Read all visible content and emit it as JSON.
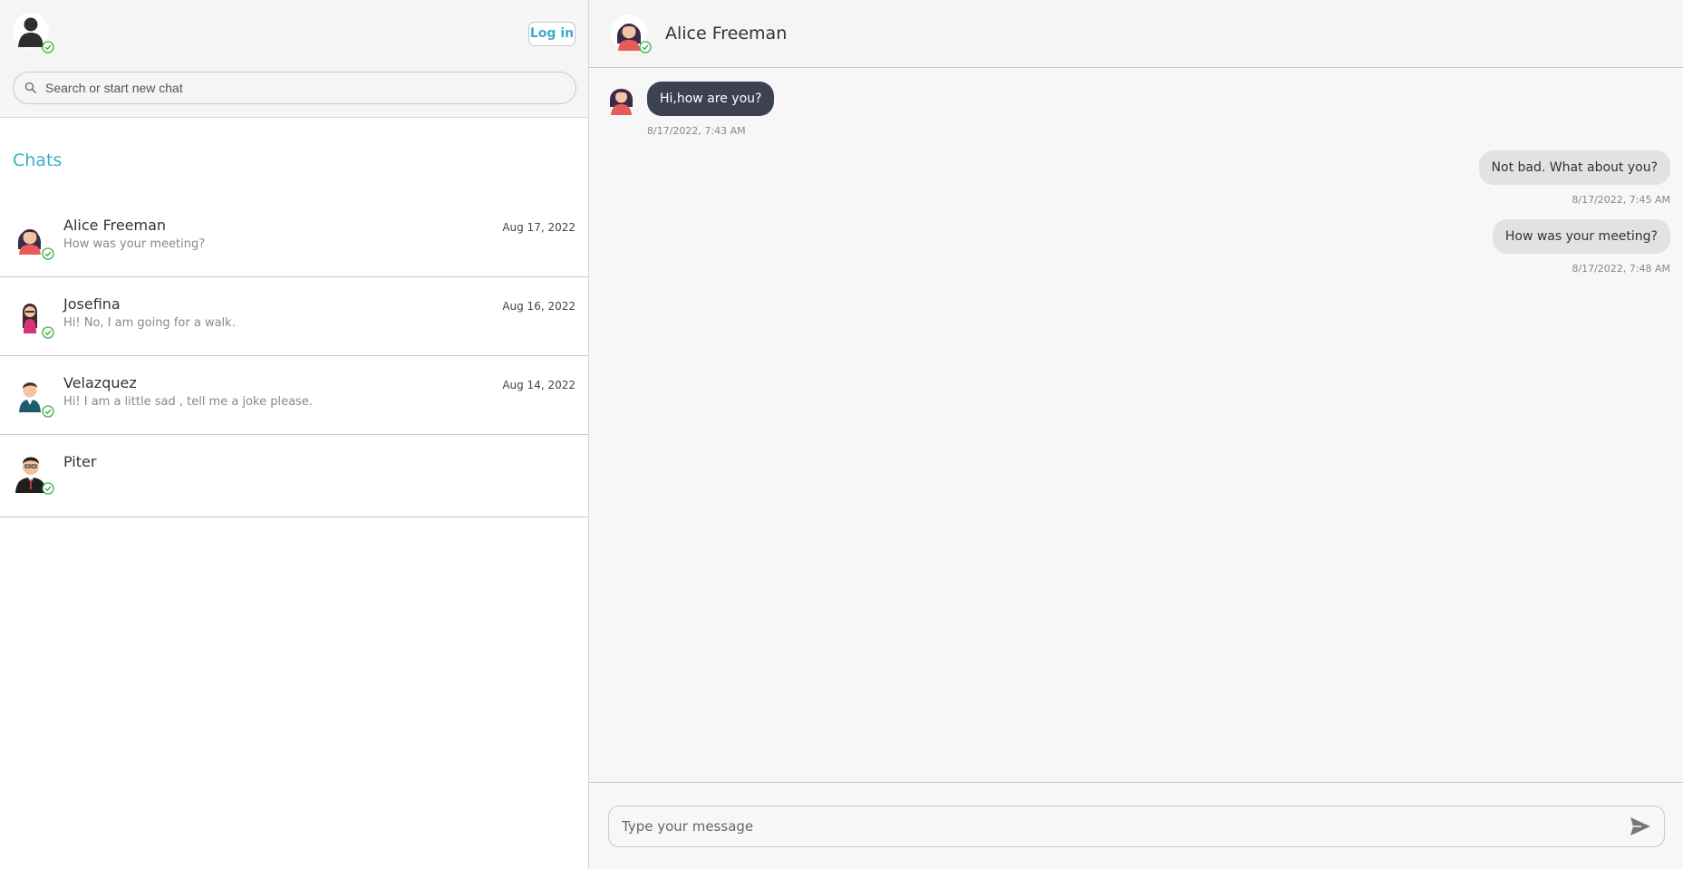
{
  "sidebar": {
    "login_label": "Log in",
    "search_placeholder": "Search or start new chat",
    "chats_title": "Chats",
    "chats": [
      {
        "name": "Alice Freeman",
        "preview": "How was your meeting?",
        "date": "Aug 17, 2022"
      },
      {
        "name": "Josefina",
        "preview": "Hi! No, I am going for a walk.",
        "date": "Aug 16, 2022"
      },
      {
        "name": "Velazquez",
        "preview": "Hi! I am a little sad , tell me a joke please.",
        "date": "Aug 14, 2022"
      },
      {
        "name": "Piter",
        "preview": "",
        "date": ""
      }
    ]
  },
  "conversation": {
    "title": "Alice Freeman",
    "messages": [
      {
        "direction": "in",
        "text": "Hi,how are you?",
        "time": "8/17/2022, 7:43 AM"
      },
      {
        "direction": "out",
        "text": "Not bad. What about you?",
        "time": "8/17/2022, 7:45 AM"
      },
      {
        "direction": "out",
        "text": "How was your meeting?",
        "time": "8/17/2022, 7:48 AM"
      }
    ],
    "input_placeholder": "Type your message"
  },
  "colors": {
    "accent": "#3aafc9",
    "online": "#3fae3f",
    "incoming_bubble": "#3c4250",
    "outgoing_bubble": "#e2e2e2"
  },
  "icons": {
    "search": "search-icon",
    "send": "send-icon",
    "online": "online-check-icon"
  }
}
